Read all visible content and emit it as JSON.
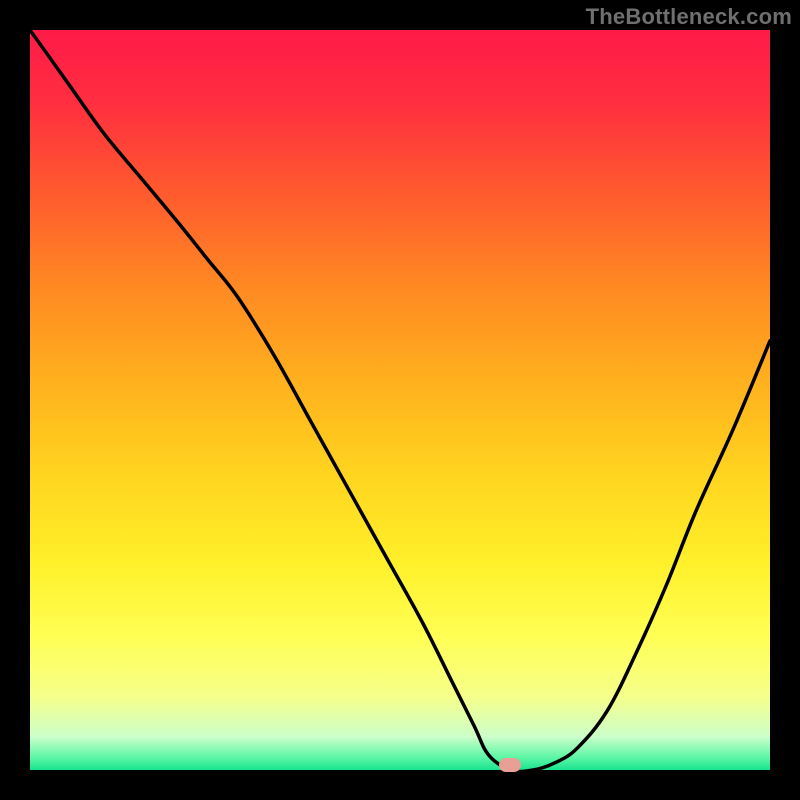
{
  "watermark": "TheBottleneck.com",
  "marker": {
    "x_pct": 64.8,
    "y_pct": 99.3,
    "color": "#e89f95"
  },
  "gradient_stops": [
    {
      "offset": 0.0,
      "color": "#ff1a47"
    },
    {
      "offset": 0.1,
      "color": "#ff2f3f"
    },
    {
      "offset": 0.22,
      "color": "#ff5a2e"
    },
    {
      "offset": 0.35,
      "color": "#ff8a22"
    },
    {
      "offset": 0.48,
      "color": "#ffb21e"
    },
    {
      "offset": 0.6,
      "color": "#ffd41f"
    },
    {
      "offset": 0.72,
      "color": "#fff02a"
    },
    {
      "offset": 0.82,
      "color": "#ffff54"
    },
    {
      "offset": 0.9,
      "color": "#f6ff8a"
    },
    {
      "offset": 0.955,
      "color": "#ccffc9"
    },
    {
      "offset": 0.985,
      "color": "#56f5a4"
    },
    {
      "offset": 1.0,
      "color": "#18e38e"
    }
  ],
  "chart_data": {
    "type": "line",
    "title": "",
    "xlabel": "",
    "ylabel": "",
    "xlim": [
      0,
      100
    ],
    "ylim": [
      0,
      100
    ],
    "gradient_axis": "y",
    "gradient_meaning": "red=high bottleneck, green=low bottleneck",
    "series": [
      {
        "name": "bottleneck-curve",
        "x": [
          0,
          5,
          10,
          15,
          20,
          24,
          28,
          33,
          38,
          43,
          48,
          53,
          57,
          60,
          62,
          65,
          68,
          71,
          74,
          78,
          82,
          86,
          90,
          95,
          100
        ],
        "y": [
          100,
          93,
          86,
          80,
          74,
          69,
          64,
          56,
          47,
          38,
          29,
          20,
          12,
          6,
          2,
          0,
          0,
          1,
          3,
          8,
          16,
          25,
          35,
          46,
          58
        ]
      }
    ],
    "marker_point": {
      "series": "bottleneck-curve",
      "x": 64.8,
      "y": 0
    },
    "annotations": [
      {
        "text": "TheBottleneck.com",
        "position": "top-right"
      }
    ]
  }
}
